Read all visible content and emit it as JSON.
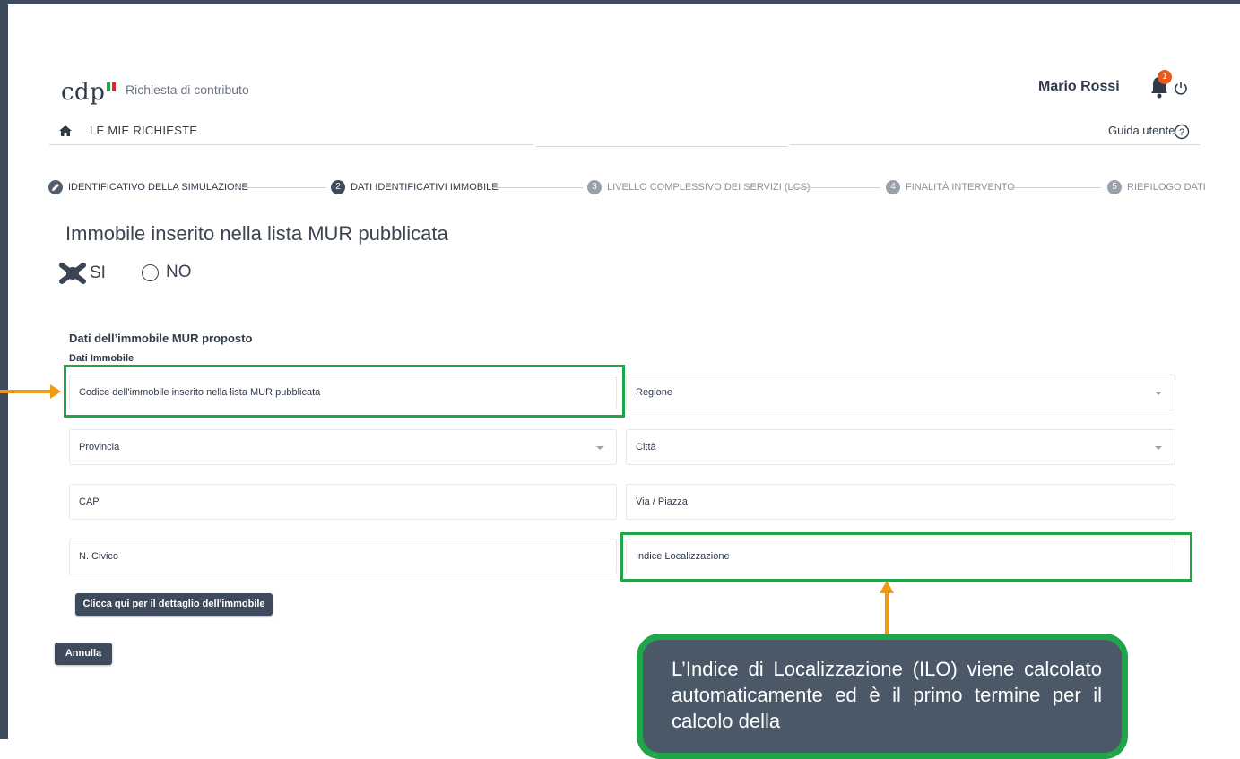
{
  "header": {
    "logo_text": "cdp",
    "app_name": "Richiesta di contributo",
    "user_name": "Mario Rossi",
    "notification_count": "1",
    "flag_colors": [
      "#1fa64a",
      "#ffffff",
      "#e3262e"
    ]
  },
  "nav": {
    "my_requests": "LE MIE RICHIESTE",
    "user_guide": "Guida utente"
  },
  "stepper": {
    "steps": [
      {
        "number": "1",
        "label": "IDENTIFICATIVO DELLA SIMULAZIONE",
        "status": "done"
      },
      {
        "number": "2",
        "label": "DATI IDENTIFICATIVI IMMOBILE",
        "status": "active"
      },
      {
        "number": "3",
        "label": "LIVELLO COMPLESSIVO DEI SERVIZI (LCS)",
        "status": "todo"
      },
      {
        "number": "4",
        "label": "FINALITÀ INTERVENTO",
        "status": "todo"
      },
      {
        "number": "5",
        "label": "RIEPILOGO DATI",
        "status": "todo"
      }
    ]
  },
  "form": {
    "question": "Immobile inserito nella lista MUR pubblicata",
    "option_yes": "SI",
    "option_no": "NO",
    "section_title": "Dati dell’immobile MUR proposto",
    "subsection_title": "Dati Immobile",
    "fields": {
      "codice": "Codice dell'immobile inserito nella lista MUR pubblicata",
      "regione": "Regione",
      "provincia": "Provincia",
      "citta": "Città",
      "cap": "CAP",
      "via": "Via / Piazza",
      "civico": "N. Civico",
      "indice": "Indice Localizzazione"
    },
    "detail_button": "Clicca qui per il dettaglio dell'immobile",
    "cancel_button": "Annulla"
  },
  "annotation": {
    "callout_text": "L’Indice di Localizzazione (ILO) viene calcolato automaticamente ed è il primo termine per il calcolo della",
    "highlight_color": "#1fa64a",
    "arrow_color": "#f39a14"
  }
}
